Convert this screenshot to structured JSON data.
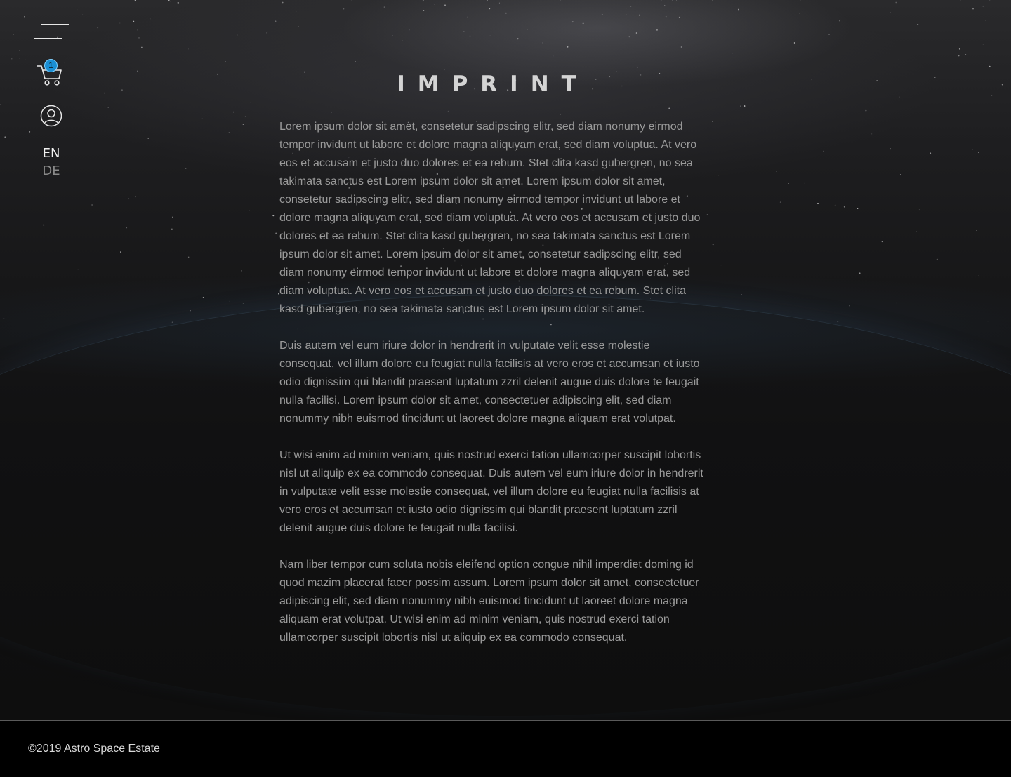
{
  "nav": {
    "cart_count": "1",
    "languages": [
      {
        "code": "EN",
        "active": true
      },
      {
        "code": "DE",
        "active": false
      }
    ],
    "icons": {
      "menu": "menu-icon",
      "cart": "cart-icon",
      "account": "user-icon"
    }
  },
  "main": {
    "title": "IMPRINT",
    "paragraphs": [
      "Lorem ipsum dolor sit amet, consetetur sadipscing elitr, sed diam nonumy eirmod tempor invidunt ut labore et dolore magna aliquyam erat, sed diam voluptua. At vero eos et accusam et justo duo dolores et ea rebum. Stet clita kasd gubergren, no sea takimata sanctus est Lorem ipsum dolor sit amet. Lorem ipsum dolor sit amet, consetetur sadipscing elitr, sed diam nonumy eirmod tempor invidunt ut labore et dolore magna aliquyam erat, sed diam voluptua. At vero eos et accusam et justo duo dolores et ea rebum. Stet clita kasd gubergren, no sea takimata sanctus est Lorem ipsum dolor sit amet. Lorem ipsum dolor sit amet, consetetur sadipscing elitr, sed diam nonumy eirmod tempor invidunt ut labore et dolore magna aliquyam erat, sed diam voluptua. At vero eos et accusam et justo duo dolores et ea rebum. Stet clita kasd gubergren, no sea takimata sanctus est Lorem ipsum dolor sit amet.",
      "Duis autem vel eum iriure dolor in hendrerit in vulputate velit esse molestie consequat, vel illum dolore eu feugiat nulla facilisis at vero eros et accumsan et iusto odio dignissim qui blandit praesent luptatum zzril delenit augue duis dolore te feugait nulla facilisi. Lorem ipsum dolor sit amet, consectetuer adipiscing elit, sed diam nonummy nibh euismod tincidunt ut laoreet dolore magna aliquam erat volutpat.",
      "Ut wisi enim ad minim veniam, quis nostrud exerci tation ullamcorper suscipit lobortis nisl ut aliquip ex ea commodo consequat. Duis autem vel eum iriure dolor in hendrerit in vulputate velit esse molestie consequat, vel illum dolore eu feugiat nulla facilisis at vero eros et accumsan et iusto odio dignissim qui blandit praesent luptatum zzril delenit augue duis dolore te feugait nulla facilisi.",
      "Nam liber tempor cum soluta nobis eleifend option congue nihil imperdiet doming id quod mazim placerat facer possim assum. Lorem ipsum dolor sit amet, consectetuer adipiscing elit, sed diam nonummy nibh euismod tincidunt ut laoreet dolore magna aliquam erat volutpat. Ut wisi enim ad minim veniam, quis nostrud exerci tation ullamcorper suscipit lobortis nisl ut aliquip ex ea commodo consequat."
    ]
  },
  "footer": {
    "copyright": "©2019 Astro Space Estate"
  },
  "colors": {
    "accent": "#1a8fd4",
    "background": "#0e0e0e",
    "footer": "#000000",
    "text": "#9a9a9a",
    "title": "#d4d4d4"
  }
}
